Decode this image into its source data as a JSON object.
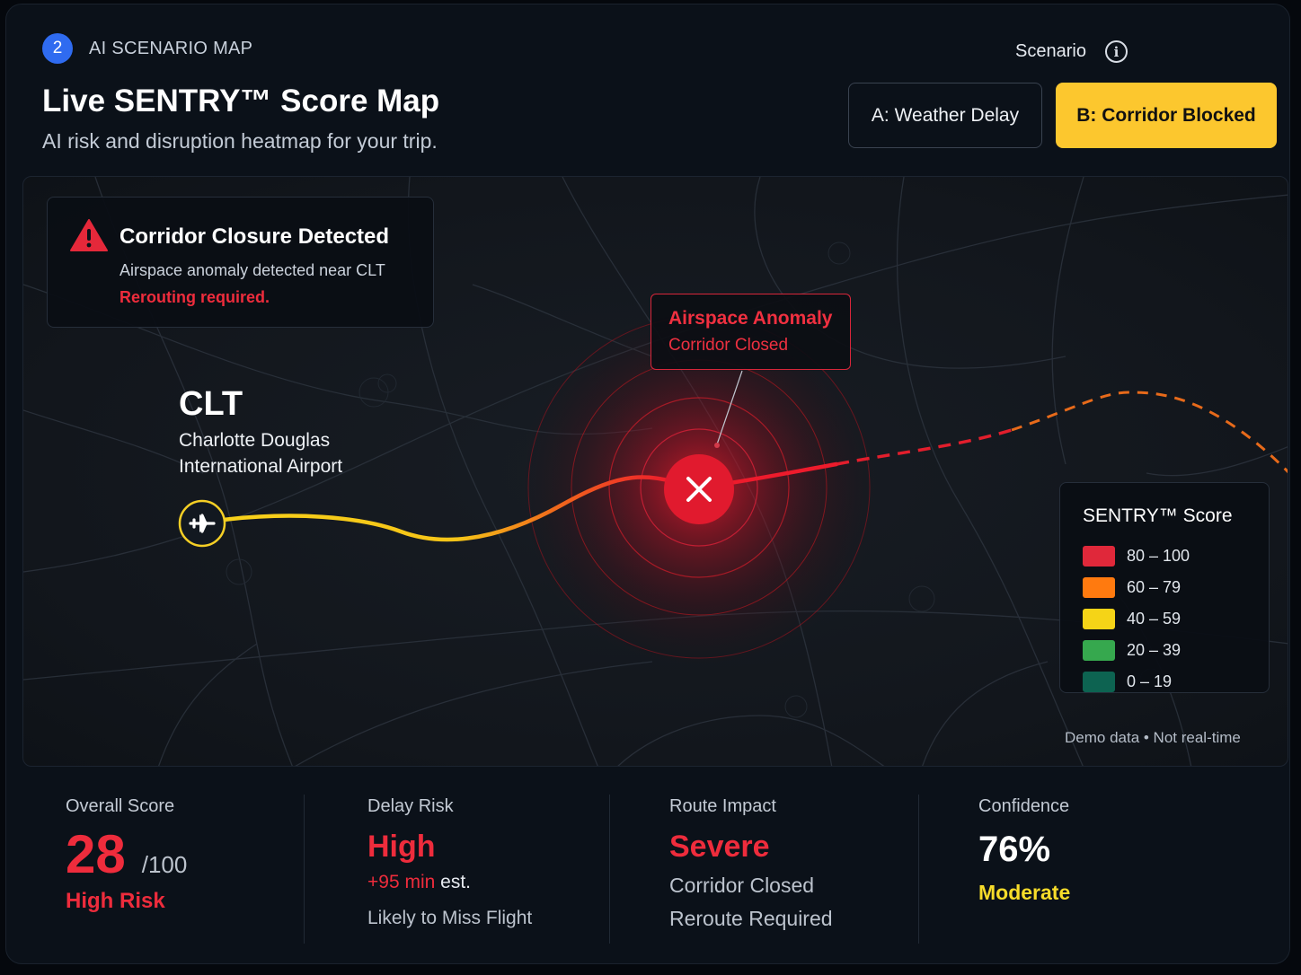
{
  "header": {
    "step_number": "2",
    "section_label": "AI SCENARIO MAP",
    "title": "Live SENTRY™ Score Map",
    "subtitle": "AI risk and disruption heatmap for your trip.",
    "scenario_label": "Scenario",
    "scenario_options": [
      {
        "label": "A: Weather Delay",
        "selected": false
      },
      {
        "label": "B: Corridor Blocked",
        "selected": true
      }
    ]
  },
  "alert": {
    "title": "Corridor Closure Detected",
    "text": "Airspace anomaly detected near CLT",
    "action": "Rerouting required."
  },
  "anomaly": {
    "title": "Airspace Anomaly",
    "subtitle": "Corridor Closed"
  },
  "airport": {
    "code": "CLT",
    "name_line1": "Charlotte Douglas",
    "name_line2": "International Airport"
  },
  "legend": {
    "title": "SENTRY™ Score",
    "items": [
      {
        "label": "80 – 100",
        "color": "#e0283a"
      },
      {
        "label": "60 – 79",
        "color": "#ff7a0f"
      },
      {
        "label": "40 – 59",
        "color": "#f5d417"
      },
      {
        "label": "20 – 39",
        "color": "#36a84e"
      },
      {
        "label": "0 – 19",
        "color": "#0d6351"
      }
    ]
  },
  "footnote": "Demo data • Not real-time",
  "stats": {
    "overall": {
      "label": "Overall Score",
      "value": "28",
      "suffix": "/100",
      "level": "High Risk"
    },
    "delay": {
      "label": "Delay Risk",
      "value": "High",
      "minutes": "+95 min",
      "minutes_suffix": "est.",
      "note": "Likely to Miss Flight"
    },
    "route": {
      "label": "Route Impact",
      "value": "Severe",
      "line1": "Corridor Closed",
      "line2": "Reroute Required"
    },
    "confidence": {
      "label": "Confidence",
      "value": "76%",
      "level": "Moderate"
    }
  },
  "colors": {
    "accent_yellow": "#fcc72e",
    "risk_red": "#ee2c3c",
    "step_blue": "#2f6bf0"
  },
  "icons": {
    "step": "step-number-badge",
    "info": "info-icon",
    "alert": "warning-triangle-icon",
    "airport": "airplane-icon",
    "anomaly": "close-x-icon"
  }
}
